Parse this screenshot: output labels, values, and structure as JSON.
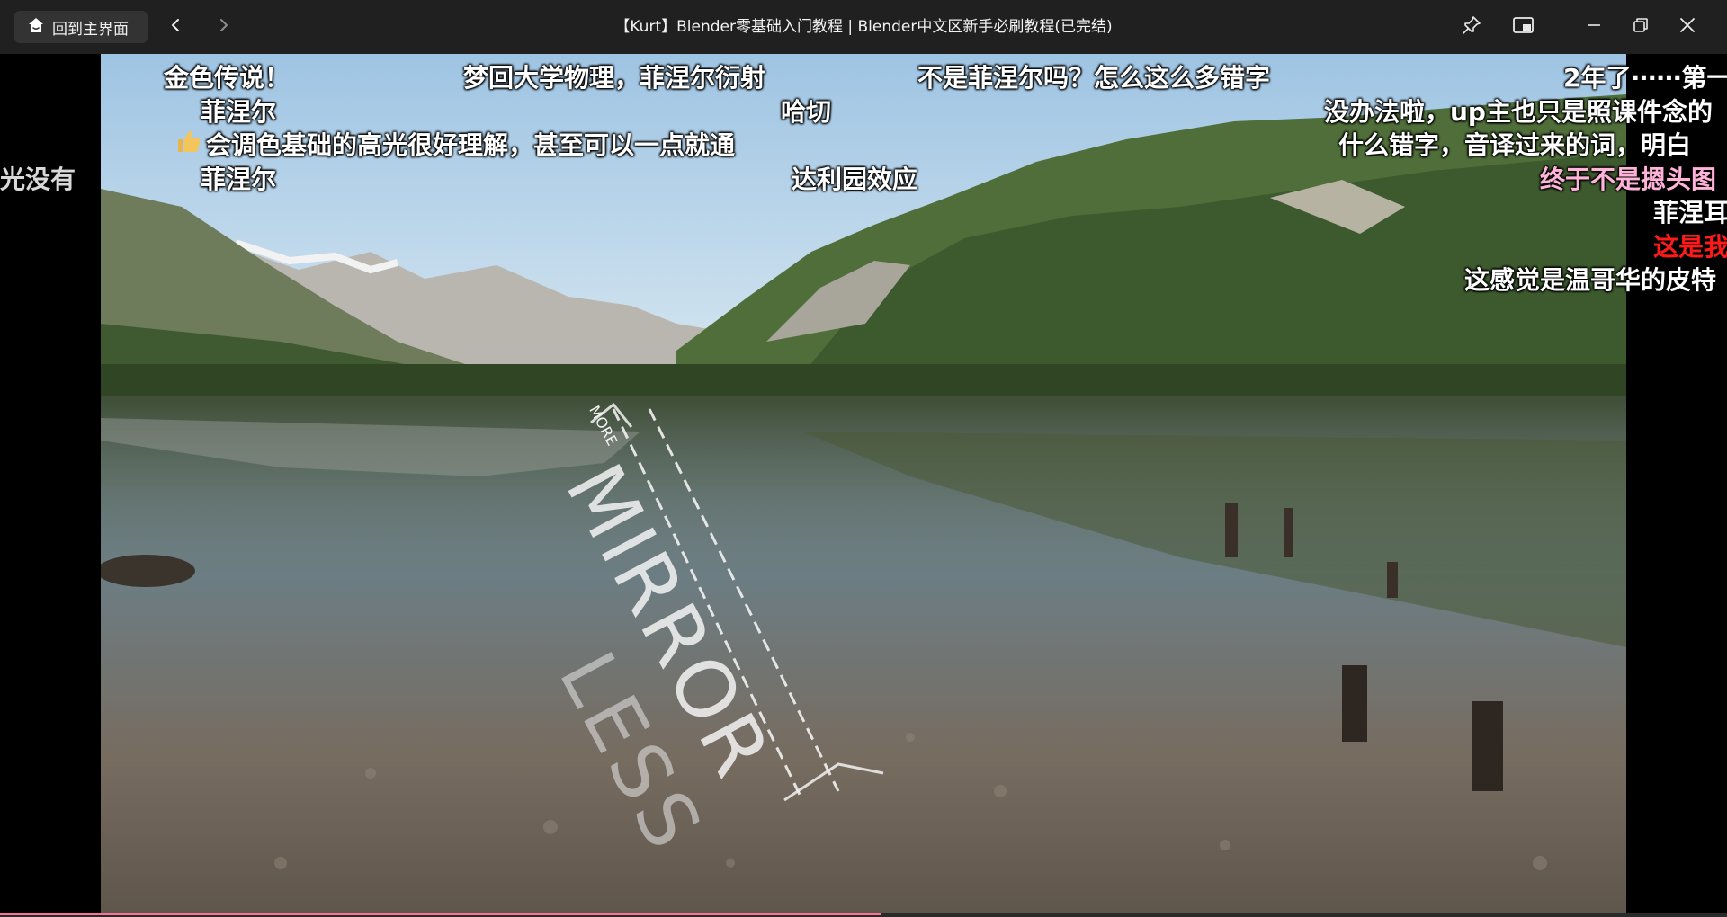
{
  "titlebar": {
    "home_label": "回到主界面",
    "title": "【Kurt】Blender零基础入门教程 | Blender中文区新手必刷教程(已完结)"
  },
  "icons": {
    "home": "home-icon",
    "back": "chevron-left-icon",
    "forward": "chevron-right-icon",
    "pin": "pin-icon",
    "pip": "picture-in-picture-icon",
    "minimize": "minimize-icon",
    "restore": "restore-icon",
    "close": "close-icon"
  },
  "video": {
    "overlay_mirror": "MIRROR",
    "overlay_less": "LESS",
    "overlay_more": "MORE",
    "progress_fraction": 0.51
  },
  "danmaku": [
    {
      "text": "金色传说！",
      "color": "white"
    },
    {
      "text": "梦回大学物理，菲涅尔衍射",
      "color": "white"
    },
    {
      "text": "不是菲涅尔吗？怎么这么多错字",
      "color": "white"
    },
    {
      "text": "2年了⋯⋯第一",
      "color": "white"
    },
    {
      "text": "菲涅尔",
      "color": "white"
    },
    {
      "text": "哈切",
      "color": "white"
    },
    {
      "text": "没办法啦，up主也只是照课件念的",
      "color": "white"
    },
    {
      "text": "会调色基础的高光很好理解，甚至可以一点就通",
      "color": "white"
    },
    {
      "text": "什么错字，音译过来的词，明白",
      "color": "white"
    },
    {
      "text": "光没有",
      "color": "white"
    },
    {
      "text": "菲涅尔",
      "color": "white"
    },
    {
      "text": "达利园效应",
      "color": "white"
    },
    {
      "text": "终于不是摁头图",
      "color": "pink"
    },
    {
      "text": "菲涅耳",
      "color": "white"
    },
    {
      "text": "这是我",
      "color": "red"
    },
    {
      "text": "这感觉是温哥华的皮特",
      "color": "white"
    }
  ],
  "colors": {
    "titlebar_bg": "#202020",
    "progress": "#fb7299",
    "danmaku_pink": "#ffb3d9",
    "danmaku_red": "#ff1a1a"
  }
}
